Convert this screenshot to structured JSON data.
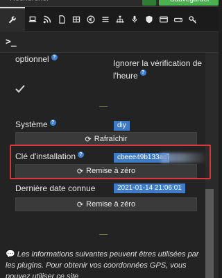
{
  "topbar": {
    "search_value": "Rechercher",
    "save_label": "Sauvegarder"
  },
  "tabs": [
    {
      "icon": "wrench-icon"
    },
    {
      "icon": "laptop-icon"
    },
    {
      "icon": "rss-icon"
    },
    {
      "icon": "file-icon"
    },
    {
      "icon": "table-icon"
    },
    {
      "icon": "euro-icon"
    },
    {
      "icon": "list-icon"
    },
    {
      "icon": "sitemap-icon"
    },
    {
      "icon": "microphone-icon"
    },
    {
      "icon": "shield-icon"
    },
    {
      "icon": "credit-card-icon"
    },
    {
      "icon": "hdd-icon"
    },
    {
      "icon": "key-icon"
    }
  ],
  "terminal": {
    "label": ">_"
  },
  "form": {
    "optionnel_label": "optionnel",
    "ignore_label_line1": "Ignorer la vérification de",
    "ignore_label_line2": "l'heure",
    "system_label": "Système",
    "system_value": "diy",
    "refresh_label": "Rafraîchir",
    "install_key_label": "Clé d'installation",
    "install_key_value": "cbeee49b133ac7",
    "reset1_label": "Remise à zéro",
    "last_date_label": "Dernière date connue",
    "last_date_value": "2021-01-14 21:06:01",
    "reset2_label": "Remise à zéro"
  },
  "info": {
    "text": "Les informations suivantes peuvent êtres utilisées par les plugins. Pour obtenir vos coordonnées GPS, vous pouvez utiliser ce site"
  }
}
